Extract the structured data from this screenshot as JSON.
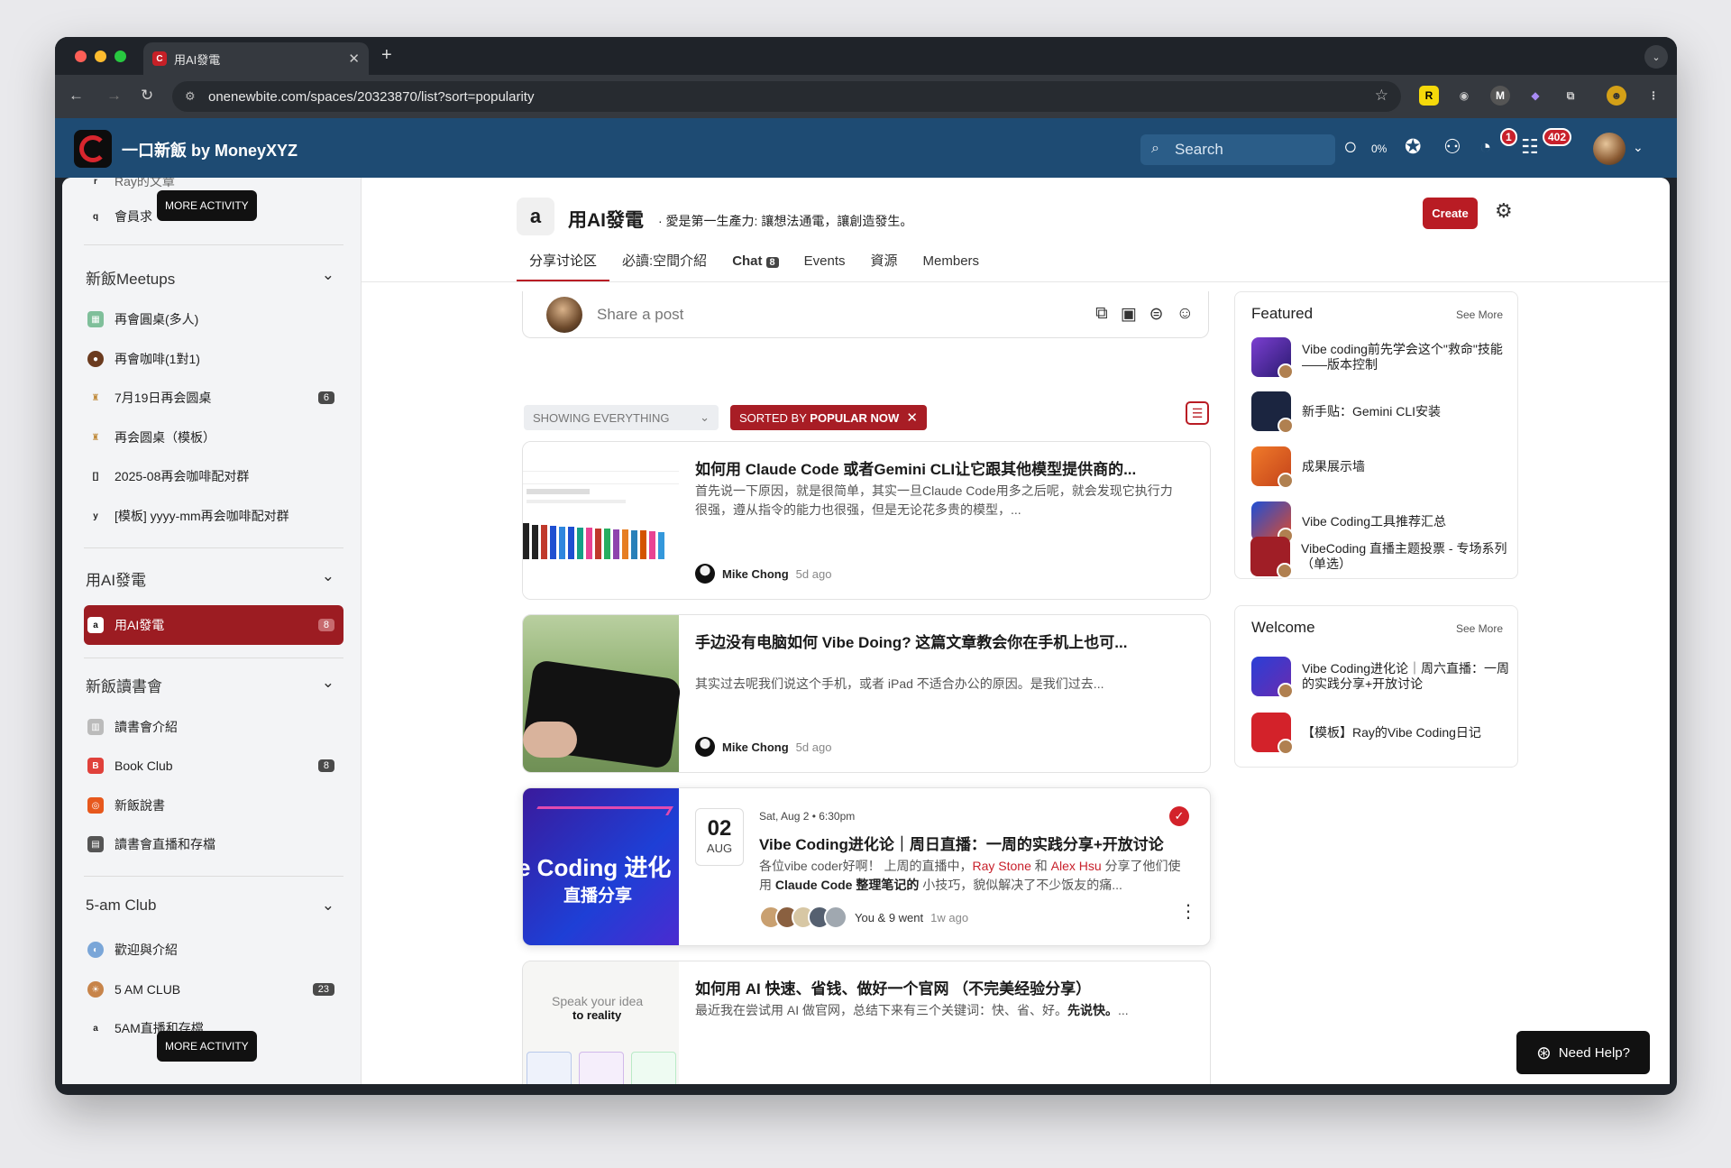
{
  "browser": {
    "tab_title": "用AI發電",
    "url": "onenewbite.com/spaces/20323870/list?sort=popularity"
  },
  "header": {
    "brand": "一口新飯 by MoneyXYZ",
    "search_placeholder": "Search",
    "progress": "0%",
    "notif_count": "1",
    "inbox_count": "402"
  },
  "sidebar": {
    "top_item": "Ray的文章",
    "member_item": "會員求",
    "member_icon": "q",
    "tooltip": "MORE ACTIVITY",
    "groups": [
      {
        "title": "新飯Meetups",
        "items": [
          {
            "label": "再會圓桌(多人)",
            "count": ""
          },
          {
            "label": "再會咖啡(1對1)",
            "count": ""
          },
          {
            "label": "7月19日再会圆桌",
            "count": "6"
          },
          {
            "label": "再会圆桌（模板）",
            "count": ""
          },
          {
            "label": "2025-08再会咖啡配对群",
            "count": "",
            "icon": "[]"
          },
          {
            "label": "[模板] yyyy-mm再会咖啡配对群",
            "count": "",
            "icon": "y"
          }
        ]
      },
      {
        "title": "用AI發電",
        "items": [
          {
            "label": "用AI發電",
            "count": "8",
            "icon": "a"
          }
        ]
      },
      {
        "title": "新飯讀書會",
        "items": [
          {
            "label": "讀書會介紹",
            "count": ""
          },
          {
            "label": "Book Club",
            "count": "8"
          },
          {
            "label": "新飯說書",
            "count": ""
          },
          {
            "label": "讀書會直播和存檔",
            "count": ""
          }
        ]
      },
      {
        "title": "5-am Club",
        "items": [
          {
            "label": "歡迎與介紹",
            "count": ""
          },
          {
            "label": "5 AM CLUB",
            "count": "23"
          },
          {
            "label": "5AM直播和存檔",
            "count": "",
            "icon": "a"
          }
        ]
      }
    ]
  },
  "space": {
    "logo": "a",
    "title": "用AI發電",
    "desc": "· 愛是第一生產力: 讓想法通電，讓創造發生。",
    "create_label": "Create",
    "tabs": [
      "分享讨论区",
      "必讀:空間介紹",
      "Chat",
      "Events",
      "資源",
      "Members"
    ],
    "chat_count": "8"
  },
  "composer": {
    "placeholder": "Share a post"
  },
  "filters": {
    "showing": "SHOWING EVERYTHING",
    "sorted_prefix": "SORTED BY ",
    "sorted_value": "POPULAR NOW"
  },
  "posts": [
    {
      "title": "如何用 Claude Code 或者Gemini CLI让它跟其他模型提供商的...",
      "body": "首先说一下原因，就是很简单，其实一旦Claude Code用多之后呢，就会发现它执行力很强，遵从指令的能力也很强，但是无论花多贵的模型，...",
      "author": "Mike Chong",
      "ago": "5d ago"
    },
    {
      "title": "手边没有电脑如何 Vibe Doing? 这篇文章教会你在手机上也可...",
      "body": "其实过去呢我们说这个手机，或者 iPad 不适合办公的原因。是我们过去...",
      "author": "Mike Chong",
      "ago": "5d ago"
    },
    {
      "event_day": "02",
      "event_month": "AUG",
      "event_time": "Sat, Aug 2 • 6:30pm",
      "title": "Vibe Coding进化论｜周日直播：一周的实践分享+开放讨论",
      "body_pre": "各位vibe coder好啊！ 上周的直播中，",
      "name1": "Ray Stone",
      "body_and": " 和 ",
      "name2": "Alex Hsu",
      "body_mid": " 分享了他们使用 ",
      "body_bold": "Claude Code 整理笔记的",
      "body_post": " 小技巧，貌似解决了不少饭友的痛...",
      "went": "You & 9 went",
      "ago": "1w ago",
      "img_text1": "e Coding 进化",
      "img_text2": "直播分享"
    },
    {
      "title": "如何用 AI 快速、省钱、做好一个官网 （不完美经验分享）",
      "body_pre": "最近我在尝试用 AI 做官网，总结下来有三个关键词：快、省、好。",
      "body_bold": "先说快。",
      "body_post": "...",
      "img_text1": "Speak your idea",
      "img_text2": "to reality"
    }
  ],
  "featured": {
    "title": "Featured",
    "see_more": "See More",
    "items": [
      "Vibe coding前先学会这个\"救命\"技能——版本控制",
      "新手贴：Gemini CLI安装",
      "成果展示墙",
      "Vibe Coding工具推荐汇总",
      "VibeCoding 直播主题投票 - 专场系列（单选）"
    ]
  },
  "welcome": {
    "title": "Welcome",
    "see_more": "See More",
    "items": [
      "Vibe Coding进化论｜周六直播：一周的实践分享+开放讨论",
      "【模板】Ray的Vibe Coding日记"
    ]
  },
  "help_label": "Need Help?",
  "colors": {
    "brand_red": "#b91c24",
    "header_blue": "#1e4b73"
  }
}
